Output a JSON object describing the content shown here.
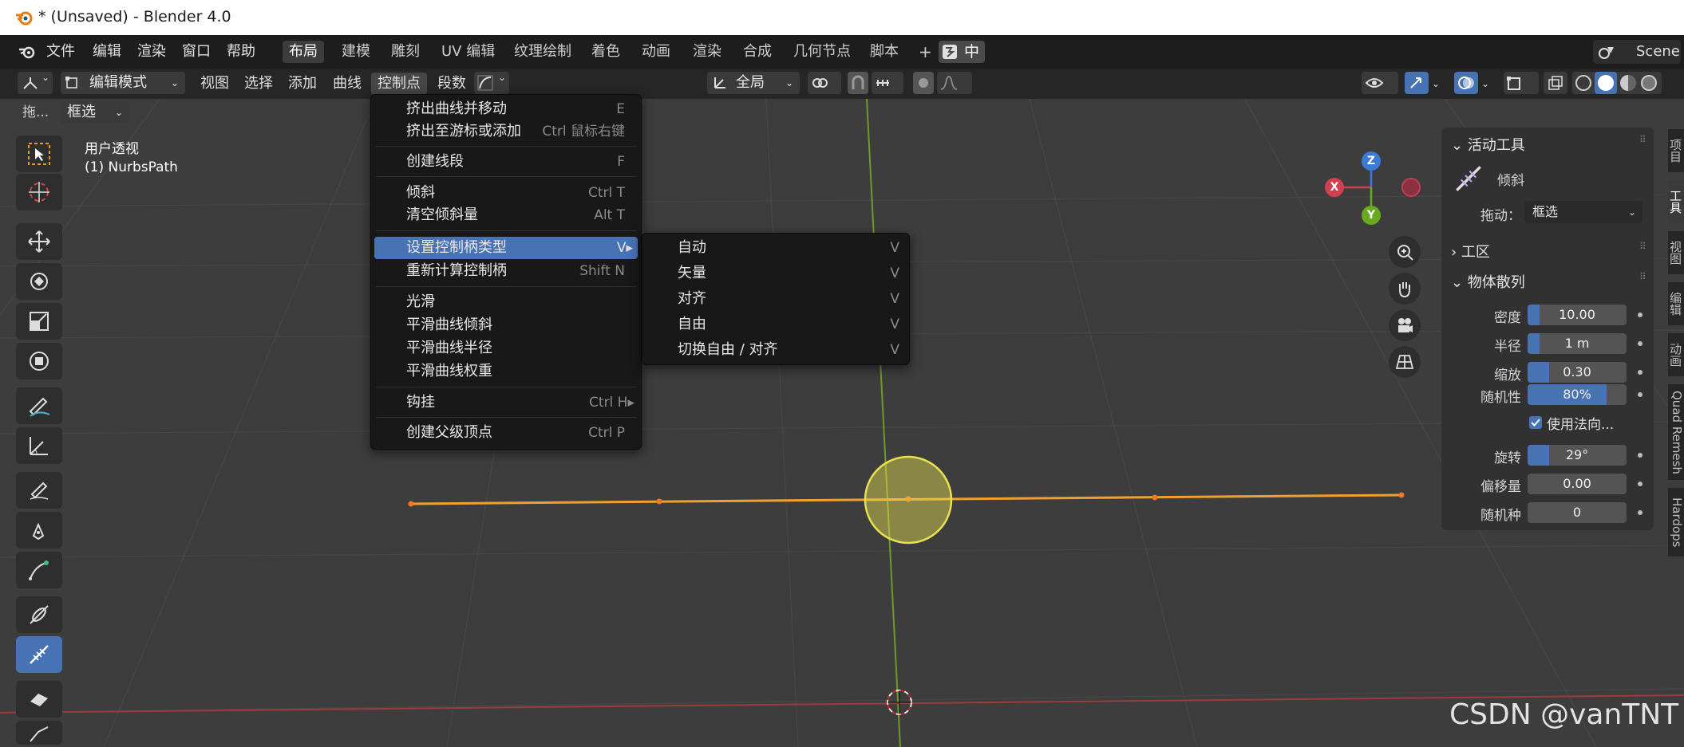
{
  "window": {
    "title": "* (Unsaved) - Blender 4.0"
  },
  "topmenu": {
    "items": [
      "文件",
      "编辑",
      "渲染",
      "窗口",
      "帮助"
    ],
    "workspaces": [
      "布局",
      "建模",
      "雕刻",
      "UV 编辑",
      "纹理绘制",
      "着色",
      "动画",
      "渲染",
      "合成",
      "几何节点",
      "脚本"
    ],
    "active_workspace": "布局",
    "add_tab": "+",
    "ime": "中",
    "scene": "Scene"
  },
  "header": {
    "mode": "编辑模式",
    "menus": [
      "视图",
      "选择",
      "添加",
      "曲线",
      "控制点",
      "段数"
    ],
    "active_menu": "控制点",
    "pivot": "全局"
  },
  "toolhdr": {
    "drag_label": "拖...",
    "select_mode": "框选"
  },
  "viewport": {
    "view_name": "用户透视",
    "object_name": "(1) NurbsPath"
  },
  "context_menu": {
    "items": [
      {
        "label": "挤出曲线并移动",
        "shortcut": "E"
      },
      {
        "label": "挤出至游标或添加",
        "shortcut": "Ctrl 鼠标右键"
      },
      {
        "label": "创建线段",
        "shortcut": "F"
      },
      {
        "label": "倾斜",
        "shortcut": "Ctrl T"
      },
      {
        "label": "清空倾斜量",
        "shortcut": "Alt T"
      },
      {
        "label": "设置控制柄类型",
        "shortcut": "V▸"
      },
      {
        "label": "重新计算控制柄",
        "shortcut": "Shift N"
      },
      {
        "label": "光滑",
        "shortcut": ""
      },
      {
        "label": "平滑曲线倾斜",
        "shortcut": ""
      },
      {
        "label": "平滑曲线半径",
        "shortcut": ""
      },
      {
        "label": "平滑曲线权重",
        "shortcut": ""
      },
      {
        "label": "钩挂",
        "shortcut": "Ctrl H▸"
      },
      {
        "label": "创建父级顶点",
        "shortcut": "Ctrl P"
      }
    ]
  },
  "submenu": {
    "items": [
      {
        "label": "自动",
        "shortcut": "V"
      },
      {
        "label": "矢量",
        "shortcut": "V"
      },
      {
        "label": "对齐",
        "shortcut": "V"
      },
      {
        "label": "自由",
        "shortcut": "V"
      },
      {
        "label": "切换自由 / 对齐",
        "shortcut": "V"
      }
    ]
  },
  "gizmo": {
    "z": "Z",
    "x": "X",
    "y": "Y"
  },
  "npanel": {
    "active_tool_title": "活动工具",
    "tool_name": "倾斜",
    "drag_label": "拖动：",
    "drag_value": "框选",
    "workspace_title": "工区",
    "scatter_title": "物体散列",
    "fields": [
      {
        "label": "密度",
        "value": "10.00",
        "fill": 0.12
      },
      {
        "label": "半径",
        "value": "1 m",
        "fill": 0.12
      },
      {
        "label": "缩放",
        "value": "0.30",
        "fill": 0.22
      },
      {
        "label": "随机性",
        "value": "80%",
        "fill": 0.8
      },
      {
        "label": "旋转",
        "value": "29°",
        "fill": 0.22
      },
      {
        "label": "偏移量",
        "value": "0.00",
        "fill": 0.0
      },
      {
        "label": "随机种",
        "value": "0",
        "fill": 0.0
      }
    ],
    "checkbox_label": "使用法向..."
  },
  "side_tabs": [
    "项目",
    "工具",
    "视图",
    "编辑",
    "动画",
    "Quad Remesh",
    "Hardops"
  ],
  "watermark": "CSDN @vanTNT",
  "colors": {
    "accent": "#4772b3",
    "curve": "#f0a030",
    "circle": "#e8e050"
  }
}
